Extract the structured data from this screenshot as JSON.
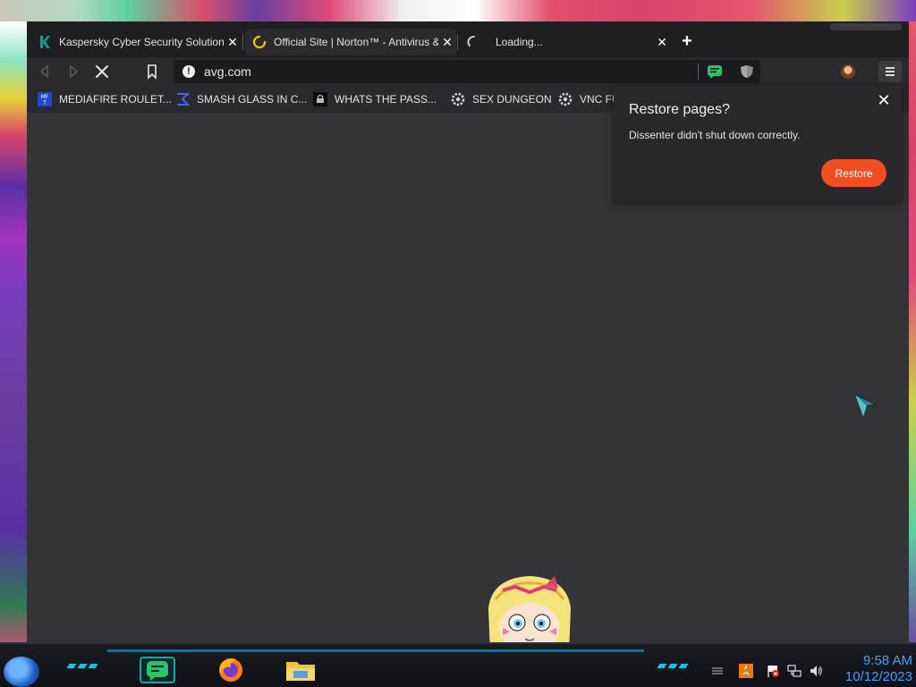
{
  "tabs": [
    {
      "title": "Kaspersky Cyber Security Solutions",
      "icon": "kaspersky-k-icon"
    },
    {
      "title": "Official Site | Norton™ - Antivirus &",
      "icon": "loading-spinner-icon"
    },
    {
      "title": "Loading...",
      "icon": "loading-spinner-icon"
    }
  ],
  "toolbar": {
    "url": "avg.com"
  },
  "bookmarks": [
    {
      "label": "MEDIAFIRE ROULET...",
      "icon": "mediafire-icon"
    },
    {
      "label": "SMASH GLASS IN C...",
      "icon": "sigma-icon"
    },
    {
      "label": "WHATS THE PASS...",
      "icon": "bookmark-site-icon"
    },
    {
      "label": "SEX DUNGEON",
      "icon": "gear-site-icon"
    },
    {
      "label": "VNC FU",
      "icon": "gear-site-icon"
    }
  ],
  "popup": {
    "title": "Restore pages?",
    "message": "Dissenter didn't shut down correctly.",
    "restore_label": "Restore"
  },
  "taskbar": {
    "time": "9:58 AM",
    "date": "10/12/2023"
  },
  "colors": {
    "accent": "#f04e23",
    "page_bg": "#343438",
    "clock": "#3fa0ff"
  }
}
